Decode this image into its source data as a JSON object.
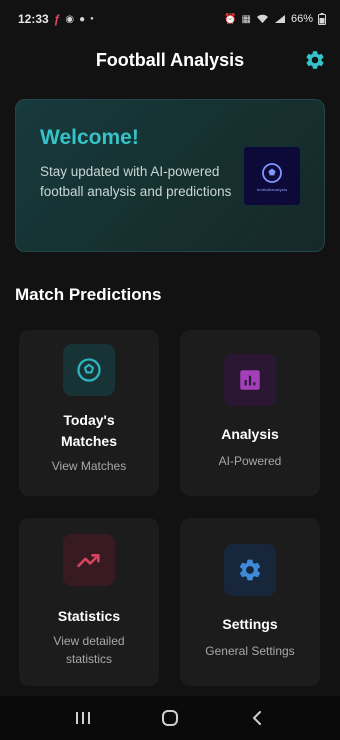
{
  "status": {
    "time": "12:33",
    "battery": "66%",
    "notifications": [
      "app-red-icon",
      "snapchat-icon",
      "facebook-icon",
      "dot-icon"
    ],
    "system_icons": [
      "alarm-icon",
      "lock-icon",
      "wifi-icon",
      "signal-icon",
      "battery-icon"
    ]
  },
  "header": {
    "title": "Football Analysis",
    "settings_icon": "gear-icon"
  },
  "welcome": {
    "title": "Welcome!",
    "text": "Stay updated with AI-powered football analysis and predictions",
    "logo_text": "footballanalysis"
  },
  "section": {
    "title": "Match Predictions"
  },
  "cards": [
    {
      "title": "Today's Matches",
      "subtitle": "View Matches",
      "icon": "football-icon",
      "color": "#2fb3c0"
    },
    {
      "title": "Analysis",
      "subtitle": "AI-Powered",
      "icon": "bar-chart-icon",
      "color": "#a33fb8"
    },
    {
      "title": "Statistics",
      "subtitle": "View detailed statistics",
      "icon": "trending-up-icon",
      "color": "#d6455c"
    },
    {
      "title": "Settings",
      "subtitle": "General Settings",
      "icon": "gear-icon",
      "color": "#3d8bd6"
    }
  ],
  "nav": {
    "recents": "recents-icon",
    "home": "home-icon",
    "back": "back-icon"
  },
  "colors": {
    "accent": "#35c2c8",
    "background": "#121212",
    "card": "#1c1c1c"
  }
}
